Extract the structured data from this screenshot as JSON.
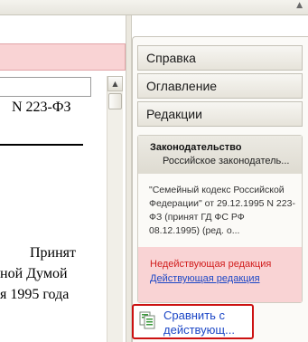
{
  "document": {
    "doc_number": "N 223-ФЗ",
    "accepted_lines": [
      "Принят",
      "ной Думой",
      "я 1995 года"
    ]
  },
  "side_panel": {
    "nav": [
      "Справка",
      "Оглавление",
      "Редакции"
    ],
    "legislation": {
      "title": "Законодательство",
      "subtitle": "Российское законодатель...",
      "description": "\"Семейный кодекс Российской Федерации\" от 29.12.1995 N 223-ФЗ (принят ГД ФС РФ 08.12.1995) (ред. о...",
      "inactive_label": "Недействующая редакция",
      "active_link": "Действующая редакция"
    },
    "compare_button": "Сравнить с действующ..."
  },
  "colors": {
    "pink": "#f9d3d4",
    "red_text": "#d11d1d",
    "link_blue": "#1c47c6",
    "highlight_border": "#cc1111"
  }
}
